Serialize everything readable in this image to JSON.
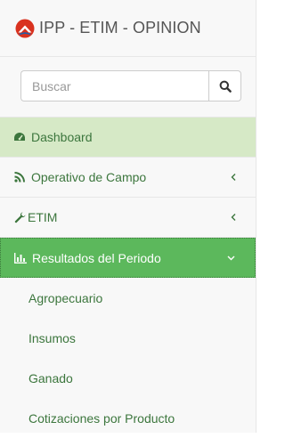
{
  "brand": {
    "title": "IPP - ETIM - OPINION"
  },
  "search": {
    "placeholder": "Buscar",
    "value": ""
  },
  "menu": [
    {
      "label": "Dashboard",
      "icon": "dashboard-icon",
      "state": "highlight"
    },
    {
      "label": "Operativo de Campo",
      "icon": "rss-icon",
      "chevron": "chevron-left-icon"
    },
    {
      "label": "ETIM",
      "icon": "wrench-icon",
      "chevron": "chevron-left-icon"
    },
    {
      "label": "Resultados del Periodo",
      "icon": "bar-chart-icon",
      "chevron": "chevron-down-icon",
      "state": "active"
    }
  ],
  "submenu": [
    {
      "label": "Agropecuario"
    },
    {
      "label": "Insumos"
    },
    {
      "label": "Ganado"
    },
    {
      "label": "Cotizaciones por Producto"
    }
  ],
  "colors": {
    "brand_red": "#d9321f",
    "text_green": "#3c763d",
    "highlight_bg": "#d6e9c6",
    "active_bg": "#5cb85c",
    "sidebar_bg": "#f8f8f8"
  }
}
